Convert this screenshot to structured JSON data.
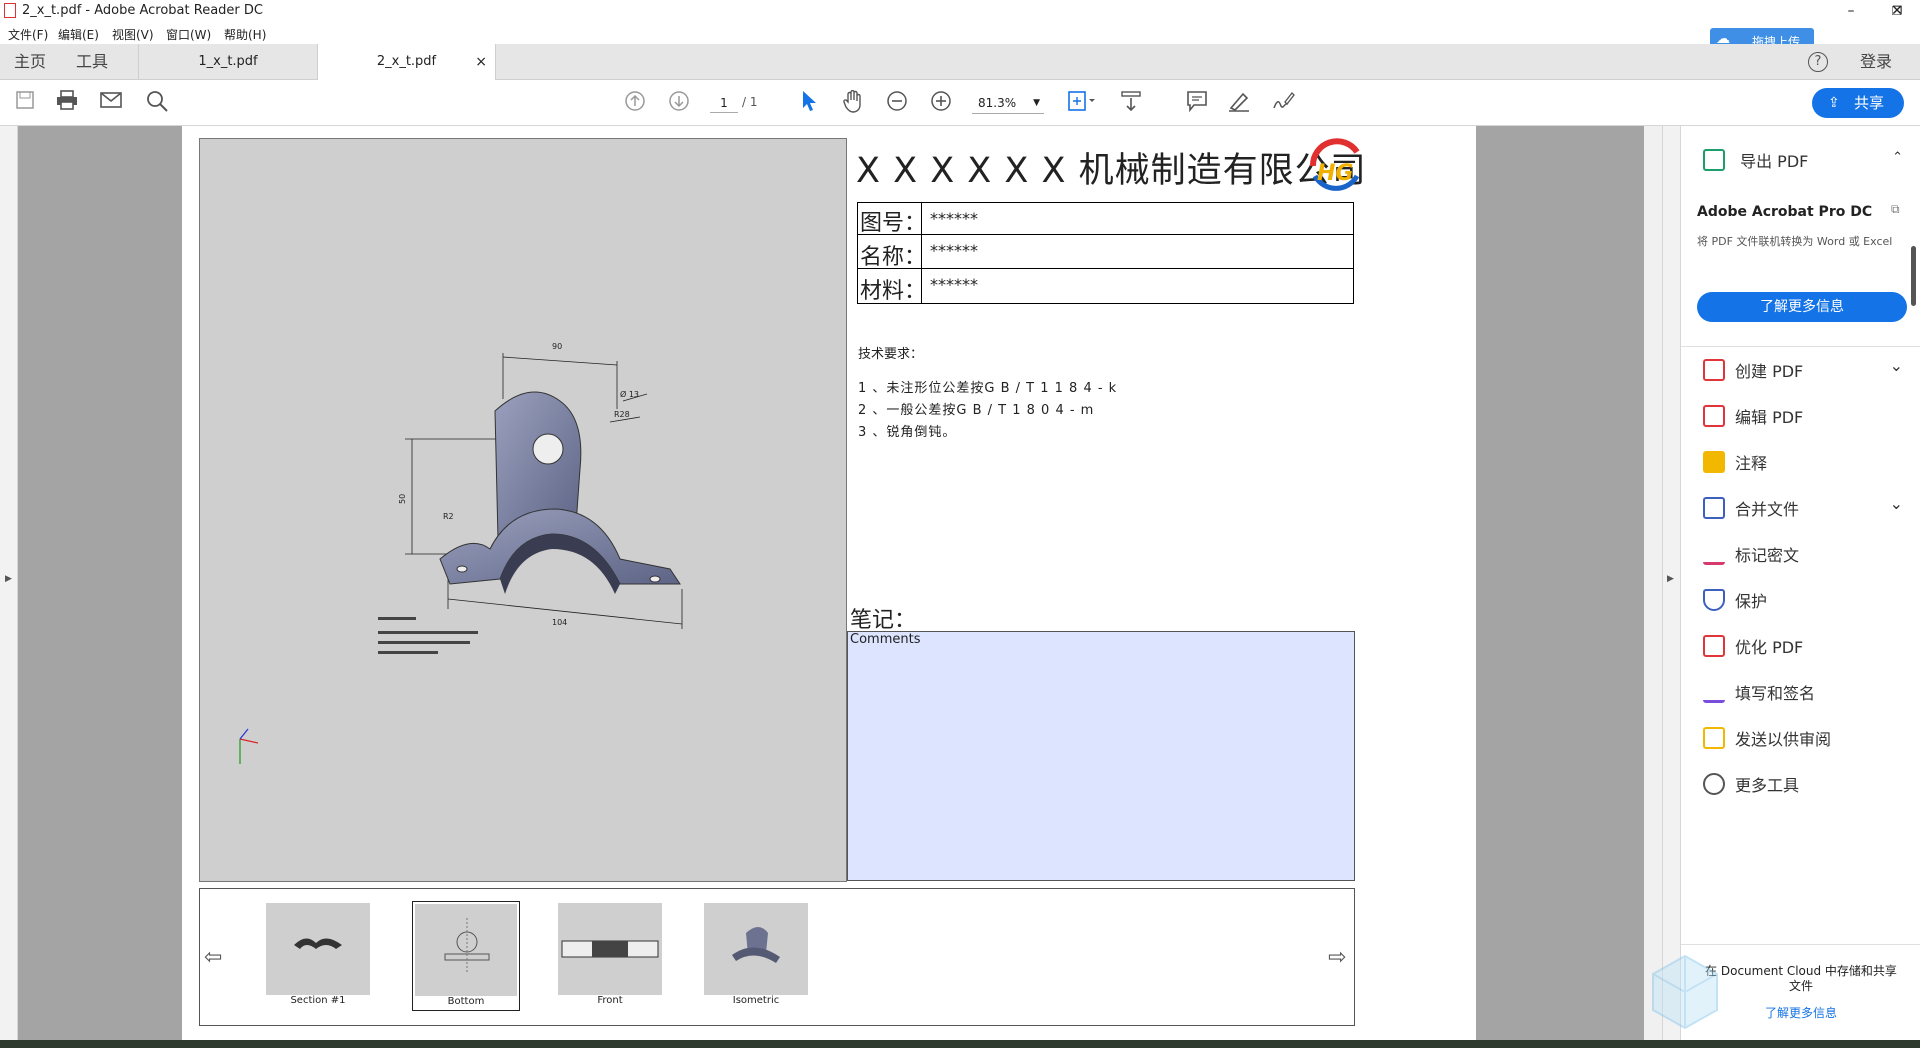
{
  "window": {
    "title": "2_x_t.pdf - Adobe Acrobat Reader DC",
    "min": "–",
    "restore": "❐",
    "close": "✕"
  },
  "menu": [
    "文件(F)",
    "编辑(E)",
    "视图(V)",
    "窗口(W)",
    "帮助(H)"
  ],
  "upload_badge": "拖拽上传",
  "nav": {
    "home": "主页",
    "tools": "工具",
    "help": "?",
    "login": "登录"
  },
  "tabs": [
    {
      "label": "1_x_t.pdf"
    },
    {
      "label": "2_x_t.pdf",
      "close": "×"
    }
  ],
  "toolbar": {
    "page_current": "1",
    "page_total": "/ 1",
    "zoom": "81.3%",
    "share": "共享"
  },
  "doc": {
    "company": "X X X X X X 机械制造有限公司",
    "logo_text": "HG",
    "fields": [
      {
        "label": "图号：",
        "value": "******"
      },
      {
        "label": "名称：",
        "value": "******"
      },
      {
        "label": "材料：",
        "value": "******"
      }
    ],
    "tech_title": "技术要求：",
    "tech_items": [
      "1 、未注形位公差按G B / T 1 1 8 4 - k",
      "2 、一般公差按G B / T 1 8 0 4 - m",
      "3 、锐角倒钝。"
    ],
    "notes_label": "笔记：",
    "comments_label": "Comments",
    "dims": {
      "d90": "90",
      "d50": "50",
      "d104": "104",
      "d13": "Ø 13",
      "r28": "R28",
      "r2": "R2"
    },
    "views": [
      {
        "label": "Section #1"
      },
      {
        "label": "Bottom"
      },
      {
        "label": "Front"
      },
      {
        "label": "Isometric"
      }
    ]
  },
  "right": {
    "export": "导出 PDF",
    "pro_title": "Adobe Acrobat Pro DC",
    "pro_desc": "将 PDF 文件联机转换为 Word 或 Excel",
    "learn_more": "了解更多信息",
    "tools": [
      {
        "label": "创建 PDF",
        "color": "#e0353b",
        "chev": "⌄"
      },
      {
        "label": "编辑 PDF",
        "color": "#e0353b",
        "chev": ""
      },
      {
        "label": "注释",
        "color": "#f2b800",
        "chev": ""
      },
      {
        "label": "合并文件",
        "color": "#3d5fbf",
        "chev": "⌄"
      },
      {
        "label": "标记密文",
        "color": "#d43a6b",
        "chev": ""
      },
      {
        "label": "保护",
        "color": "#3d5fbf",
        "chev": ""
      },
      {
        "label": "优化 PDF",
        "color": "#e0353b",
        "chev": ""
      },
      {
        "label": "填写和签名",
        "color": "#7b4ddc",
        "chev": ""
      },
      {
        "label": "发送以供审阅",
        "color": "#f2b800",
        "chev": ""
      },
      {
        "label": "更多工具",
        "color": "#555555",
        "chev": ""
      }
    ],
    "cloud_text": "在 Document Cloud 中存储和共享文件",
    "cloud_link": "了解更多信息"
  },
  "colors": {
    "accent": "#1473e6",
    "notes_bg": "#dde4ff"
  }
}
